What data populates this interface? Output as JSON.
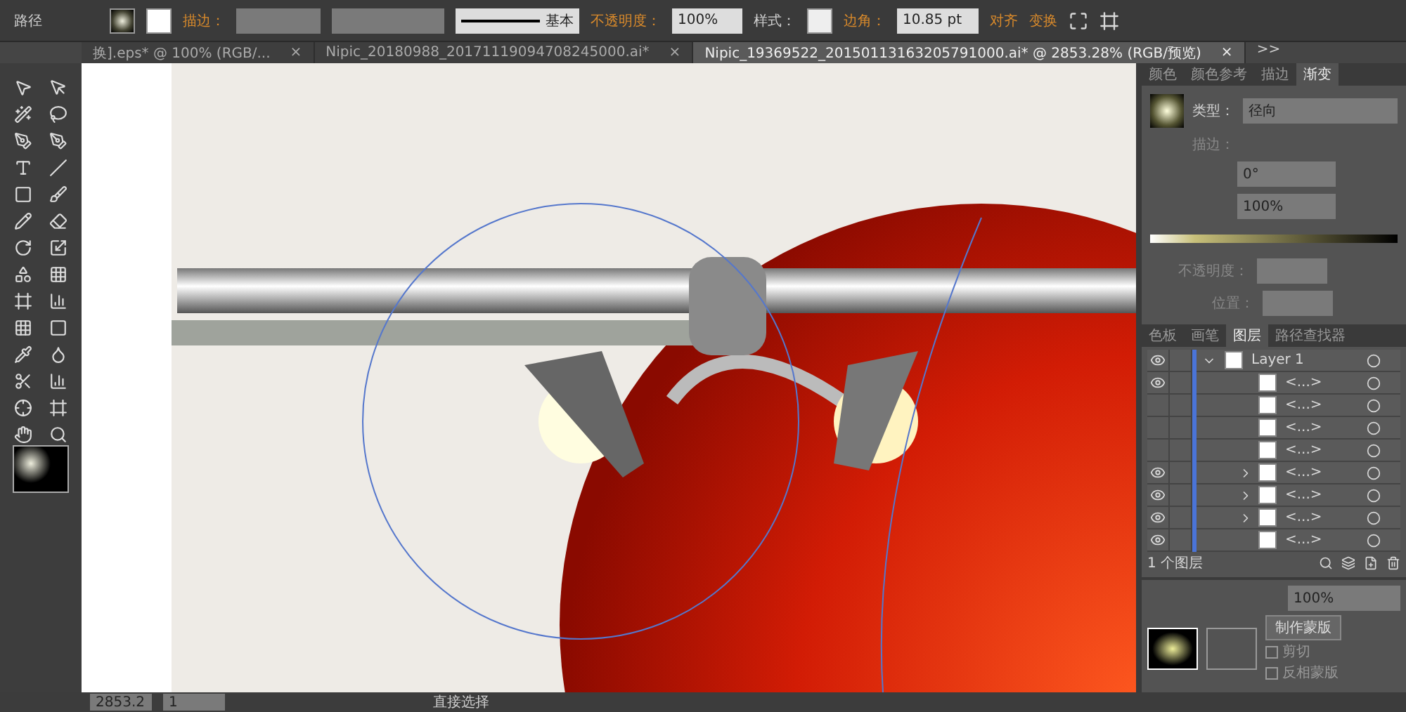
{
  "control_bar": {
    "object_label": "路径",
    "stroke_label": "描边：",
    "stroke_profile": "基本",
    "opacity_label": "不透明度：",
    "opacity": "100%",
    "style_label": "样式：",
    "corner_label": "边角：",
    "corner_value": "10.85 pt",
    "links": [
      "对齐",
      "变换"
    ]
  },
  "tabs": [
    {
      "label": "换].eps* @ 100% (RGB/...",
      "close": "×",
      "selected": false
    },
    {
      "label": "Nipic_20180988_20171119094708245000.ai*",
      "close": "×",
      "selected": false
    },
    {
      "label": "Nipic_19369522_20150113163205791000.ai* @ 2853.28% (RGB/预览)",
      "close": "×",
      "selected": true
    }
  ],
  "overflow": ">>",
  "gradient_panel": {
    "tabs": [
      {
        "label": "颜色",
        "selected": false
      },
      {
        "label": "颜色参考",
        "selected": false
      },
      {
        "label": "描边",
        "selected": false
      },
      {
        "label": "渐变",
        "selected": true
      }
    ],
    "type_label": "类型：",
    "type": "径向",
    "stroke_label": "描边：",
    "angle": "0°",
    "aspect": "100%",
    "opacity_label": "不透明度：",
    "location_label": "位置："
  },
  "layers_panel": {
    "tabs": [
      {
        "label": "色板",
        "selected": false
      },
      {
        "label": "画笔",
        "selected": false
      },
      {
        "label": "图层",
        "selected": true
      },
      {
        "label": "路径查找器",
        "selected": false
      }
    ],
    "layers": [
      {
        "name": "Layer 1",
        "kind": "layer",
        "visible": true,
        "expandable": true
      },
      {
        "name": "<...>",
        "kind": "item",
        "visible": true,
        "expandable": false
      },
      {
        "name": "<...>",
        "kind": "item",
        "visible": false,
        "expandable": false
      },
      {
        "name": "<...>",
        "kind": "item",
        "visible": false,
        "expandable": false
      },
      {
        "name": "<...>",
        "kind": "item",
        "visible": false,
        "expandable": false
      },
      {
        "name": "<...>",
        "kind": "item",
        "visible": true,
        "expandable": true
      },
      {
        "name": "<...>",
        "kind": "item",
        "visible": true,
        "expandable": true
      },
      {
        "name": "<...>",
        "kind": "item",
        "visible": true,
        "expandable": true
      },
      {
        "name": "<...>",
        "kind": "item",
        "visible": true,
        "expandable": false
      }
    ],
    "count": "1 个图层"
  },
  "transparency_panel": {
    "opacity": "100%",
    "make_mask": "制作蒙版",
    "options": [
      {
        "label": "剪切",
        "checked": false
      },
      {
        "label": "反相蒙版",
        "checked": false
      }
    ]
  },
  "status_bar": {
    "zoom": "2853.2",
    "page": "1",
    "tool": "直接选择"
  }
}
